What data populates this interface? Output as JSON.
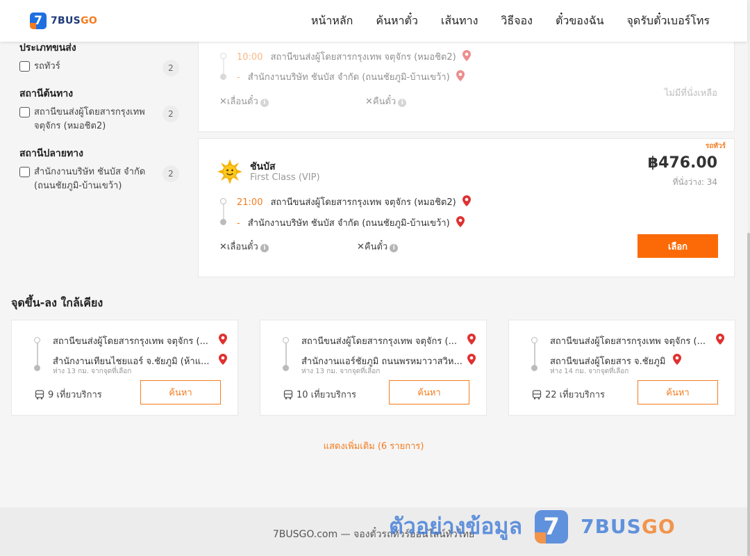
{
  "header": {
    "logo_mark": "7",
    "logo_brand": "7BUS",
    "logo_brand_suffix": "GO",
    "nav": [
      "หน้าหลัก",
      "ค้นหาตั๋ว",
      "เส้นทาง",
      "วิธีจอง",
      "ตั๋วของฉัน",
      "จุดรับตั๋วเบอร์โทร"
    ]
  },
  "sidebar": {
    "vehicle_type": {
      "title": "ประเภทขนส่ง",
      "option": "รถทัวร์",
      "count": "2"
    },
    "origin": {
      "title": "สถานีต้นทาง",
      "option": "สถานีขนส่งผู้โดยสารกรุงเทพ จตุจักร (หมอชิต2)",
      "count": "2"
    },
    "destination": {
      "title": "สถานีปลายทาง",
      "option": "สำนักงานบริษัท ชันบัส จำกัด (ถนนชัยภูมิ-บ้านเขว้า)",
      "count": "2"
    }
  },
  "trips": [
    {
      "departure_time": "10:00",
      "origin": "สถานีขนส่งผู้โดยสารกรุงเทพ จตุจักร (หมอชิต2)",
      "arrival_mark": "-",
      "destination": "สำนักงานบริษัท ชันบัส จำกัด (ถนนชัยภูมิ-บ้านเขว้า)",
      "policy_change": "เลื่อนตั๋ว",
      "policy_refund": "คืนตั๋ว",
      "status": "ไม่มีที่นั่งเหลือ"
    },
    {
      "tag": "รถทัวร์",
      "operator": "ชันบัส",
      "bus_class": "First Class (VIP)",
      "price": "฿476.00",
      "seats": "ที่นั่งว่าง: 34",
      "departure_time": "21:00",
      "origin": "สถานีขนส่งผู้โดยสารกรุงเทพ จตุจักร (หมอชิต2)",
      "arrival_mark": "-",
      "destination": "สำนักงานบริษัท ชันบัส จำกัด (ถนนชัยภูมิ-บ้านเขว้า)",
      "policy_change": "เลื่อนตั๋ว",
      "policy_refund": "คืนตั๋ว",
      "select_label": "เลือก"
    }
  ],
  "nearby": {
    "title": "จุดขึ้น-ลง ใกล้เคียง",
    "cards": [
      {
        "from": "สถานีขนส่งผู้โดยสารกรุงเทพ จตุจักร (...",
        "to": "สำนักงานเทียนไชยแอร์ จ.ชัยภูมิ (ห้าแ...",
        "distance": "ห่าง 13 กม. จากจุดที่เลือก",
        "trips": "9 เที่ยวบริการ",
        "search": "ค้นหา"
      },
      {
        "from": "สถานีขนส่งผู้โดยสารกรุงเทพ จตุจักร (...",
        "to": "สำนักงานแอร์ชัยภูมิ ถนนพรหมาวาสวิห...",
        "distance": "ห่าง 13 กม. จากจุดที่เลือก",
        "trips": "10 เที่ยวบริการ",
        "search": "ค้นหา"
      },
      {
        "from": "สถานีขนส่งผู้โดยสารกรุงเทพ จตุจักร (...",
        "to": "สถานีขนส่งผู้โดยสาร จ.ชัยภูมิ",
        "distance": "ห่าง 14 กม. จากจุดที่เลือก",
        "trips": "22 เที่ยวบริการ",
        "search": "ค้นหา"
      }
    ],
    "show_more": "แสดงเพิ่มเติม (6 รายการ)"
  },
  "footer": {
    "text": "7BUSGO.com — จองตั๋วรถทัวร์ออนไลน์ทั่วไทย"
  },
  "watermark": {
    "text": "ตัวอย่างข้อมูล",
    "logo_mark": "7",
    "brand": "7BUS",
    "brand_suffix": "GO"
  },
  "colors": {
    "accent": "#f47c20",
    "brand": "#1f6fe0",
    "button": "#fb6a06",
    "pin": "#e03131"
  }
}
